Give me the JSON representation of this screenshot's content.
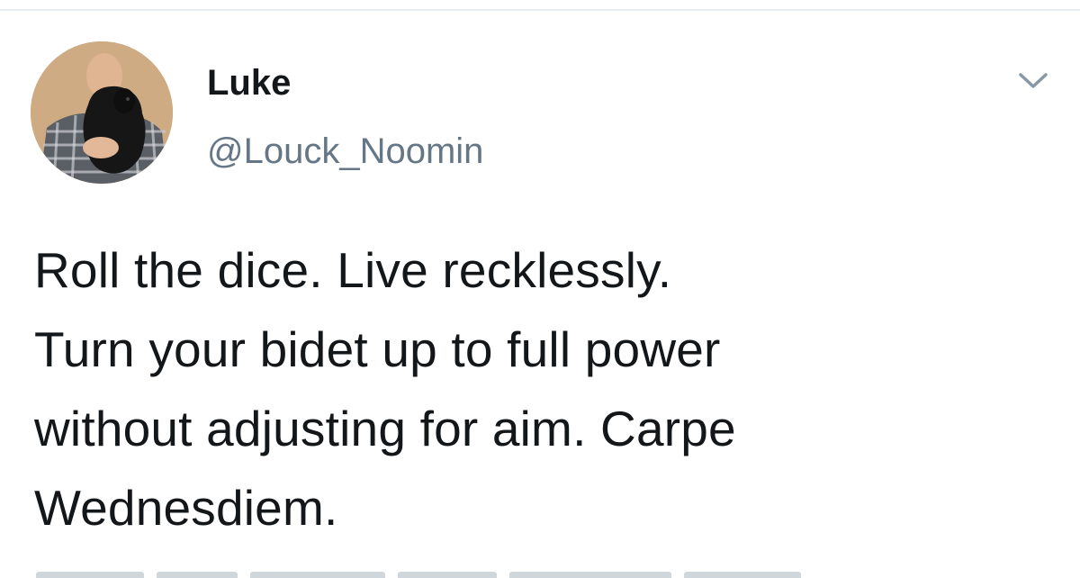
{
  "tweet": {
    "author_name": "Luke",
    "author_handle": "@Louck_Noomin",
    "text": "Roll the dice. Live recklessly.\nTurn your bidet up to full power\nwithout adjusting for aim. Carpe\nWednesdiem.",
    "menu_icon": "chevron-down-icon",
    "avatar_alt": "profile-photo"
  },
  "colors": {
    "name": "#14171a",
    "handle": "#657786",
    "text": "#14171a",
    "caret": "#8899a6",
    "divider": "#e6ecf0"
  }
}
